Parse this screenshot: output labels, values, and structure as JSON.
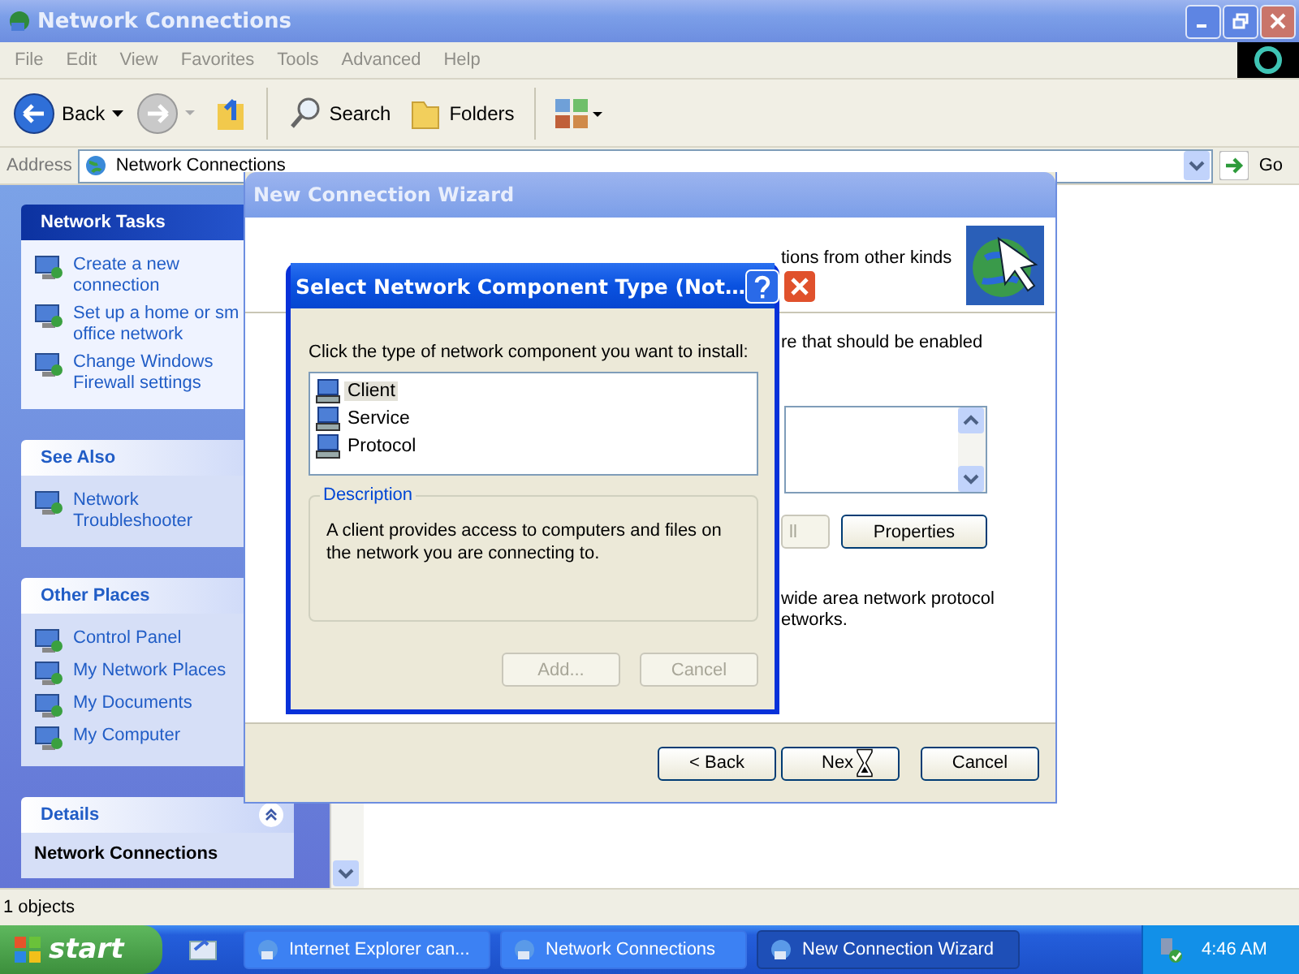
{
  "window": {
    "title": "Network Connections"
  },
  "menu": [
    "File",
    "Edit",
    "View",
    "Favorites",
    "Tools",
    "Advanced",
    "Help"
  ],
  "toolbar": {
    "back": "Back",
    "search": "Search",
    "folders": "Folders"
  },
  "address": {
    "label": "Address",
    "value": "Network Connections",
    "go": "Go"
  },
  "sidebar": {
    "panels": [
      {
        "title": "Network Tasks",
        "kind": "special",
        "items": [
          "Create a new connection",
          "Set up a home or sm office network",
          "Change Windows Firewall settings"
        ]
      },
      {
        "title": "See Also",
        "kind": "normal",
        "items": [
          "Network Troubleshooter"
        ]
      },
      {
        "title": "Other Places",
        "kind": "normal",
        "items": [
          "Control Panel",
          "My Network Places",
          "My Documents",
          "My Computer"
        ]
      },
      {
        "title": "Details",
        "kind": "details",
        "items": [
          "Network Connections"
        ]
      }
    ]
  },
  "status_bar": "1 objects",
  "wizard": {
    "title": "New Connection Wizard",
    "intro": "tions from other kinds",
    "prompt": "re that should be enabled",
    "buttons": [
      {
        "label": "ll",
        "disabled": true
      },
      {
        "label": "Properties",
        "disabled": false
      }
    ],
    "note": [
      "wide area network protocol",
      "etworks."
    ],
    "nav": [
      "< Back",
      "Nex",
      "Cancel"
    ]
  },
  "dialog": {
    "title": "Select Network Component Type (Not…",
    "prompt": "Click the type of network component you want to install:",
    "items": [
      {
        "label": "Client",
        "selected": true
      },
      {
        "label": "Service",
        "selected": false
      },
      {
        "label": "Protocol",
        "selected": false
      }
    ],
    "description_label": "Description",
    "description": "A client provides access to computers and files on the network you are connecting to.",
    "buttons": [
      {
        "label": "Add...",
        "disabled": true
      },
      {
        "label": "Cancel",
        "disabled": true
      }
    ]
  },
  "taskbar": {
    "start": "start",
    "tasks": [
      {
        "label": "Internet Explorer can...",
        "selected": false
      },
      {
        "label": "Network Connections",
        "selected": false
      },
      {
        "label": "New Connection Wizard",
        "selected": true
      }
    ],
    "clock": "4:46 AM"
  }
}
